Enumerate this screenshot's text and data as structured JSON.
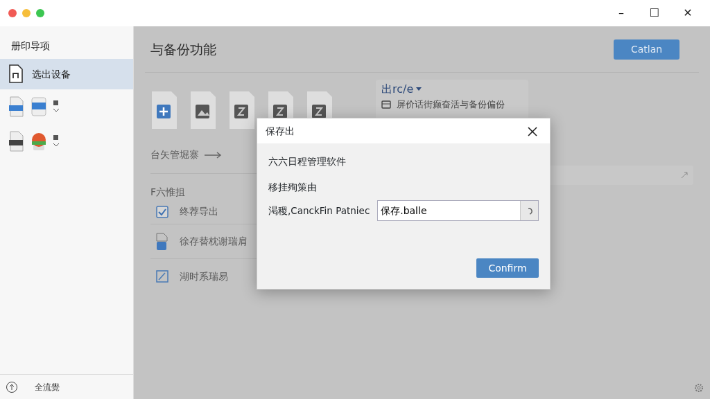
{
  "window": {
    "controls": [
      "–",
      "☐",
      "✕"
    ]
  },
  "sidebar": {
    "header": "册印导项",
    "items": [
      {
        "kind": "text",
        "label": "选出设备",
        "selected": true
      },
      {
        "kind": "icons",
        "selected": false
      },
      {
        "kind": "icons",
        "selected": false
      }
    ],
    "footer": "全流覺"
  },
  "main": {
    "title": "与备份功能",
    "button": "Catlan",
    "file_icons": [
      {
        "kind": "plus"
      },
      {
        "kind": "image"
      },
      {
        "kind": "glyph"
      },
      {
        "kind": "glyph"
      },
      {
        "kind": "glyph"
      }
    ],
    "panel": {
      "dropdown": "出rc/e",
      "row": "屏价话街癫奋活与备份偏份"
    },
    "section_link": "台矢管堀寨",
    "section_title": "F六惟抯",
    "items": [
      {
        "kind": "checkbox",
        "label": "终荐导出",
        "checked": true
      },
      {
        "kind": "doc",
        "label": "徐存替枕谢瑞肩"
      },
      {
        "kind": "edit",
        "label": "湖时系瑞易"
      }
    ]
  },
  "dialog": {
    "title": "保存出",
    "heading": "六六日程管理软件",
    "subheading": "移挂殉策由",
    "field_label": "渇稷,CanckFin Patniec",
    "field_value": "保存.balle",
    "confirm": "Confirm"
  }
}
